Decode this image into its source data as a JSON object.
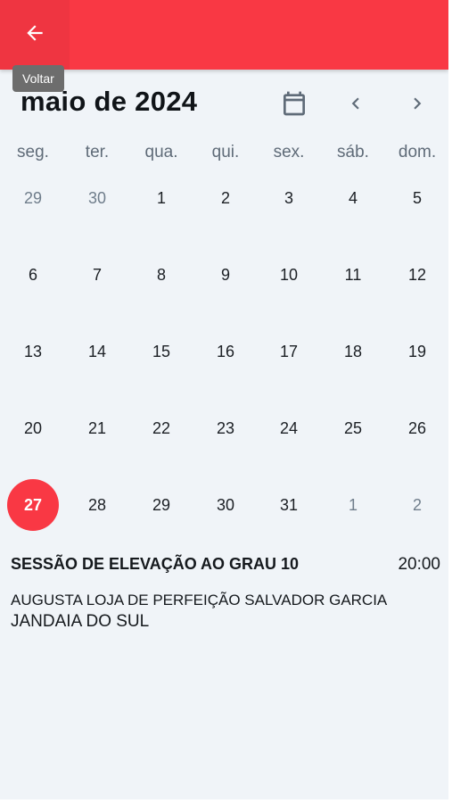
{
  "app_bar": {
    "color": "#f93844",
    "back_icon": "arrow-left-icon",
    "back_tooltip": "Voltar"
  },
  "calendar": {
    "month_title": "maio de 2024",
    "calendar_icon": "calendar-icon",
    "prev_icon": "chevron-left-icon",
    "next_icon": "chevron-right-icon",
    "weekdays": [
      "seg.",
      "ter.",
      "qua.",
      "qui.",
      "sex.",
      "sáb.",
      "dom."
    ],
    "weeks": [
      [
        {
          "d": "29",
          "out": true
        },
        {
          "d": "30",
          "out": true
        },
        {
          "d": "1"
        },
        {
          "d": "2"
        },
        {
          "d": "3"
        },
        {
          "d": "4"
        },
        {
          "d": "5"
        }
      ],
      [
        {
          "d": "6"
        },
        {
          "d": "7"
        },
        {
          "d": "8"
        },
        {
          "d": "9"
        },
        {
          "d": "10"
        },
        {
          "d": "11"
        },
        {
          "d": "12"
        }
      ],
      [
        {
          "d": "13"
        },
        {
          "d": "14"
        },
        {
          "d": "15"
        },
        {
          "d": "16"
        },
        {
          "d": "17"
        },
        {
          "d": "18"
        },
        {
          "d": "19"
        }
      ],
      [
        {
          "d": "20"
        },
        {
          "d": "21"
        },
        {
          "d": "22"
        },
        {
          "d": "23"
        },
        {
          "d": "24"
        },
        {
          "d": "25"
        },
        {
          "d": "26"
        }
      ],
      [
        {
          "d": "27",
          "selected": true
        },
        {
          "d": "28"
        },
        {
          "d": "29"
        },
        {
          "d": "30"
        },
        {
          "d": "31"
        },
        {
          "d": "1",
          "out": true
        },
        {
          "d": "2",
          "out": true
        }
      ]
    ],
    "selected_color": "#f93844"
  },
  "event": {
    "title": "SESSÃO DE ELEVAÇÃO AO GRAU 10",
    "time": "20:00",
    "location": "AUGUSTA LOJA DE PERFEIÇÃO SALVADOR GARCIA",
    "city": "JANDAIA DO SUL"
  }
}
